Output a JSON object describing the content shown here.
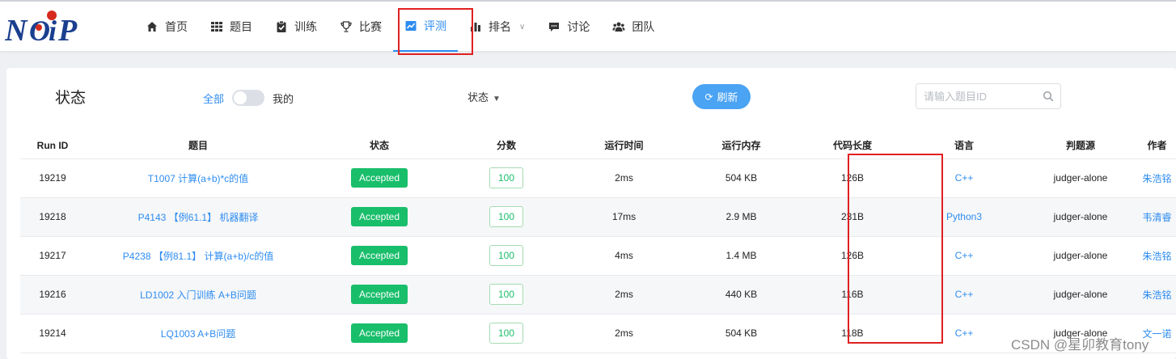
{
  "nav": {
    "items": [
      {
        "label": "首页",
        "icon": "home-icon"
      },
      {
        "label": "题目",
        "icon": "grid-icon"
      },
      {
        "label": "训练",
        "icon": "clipboard-check-icon"
      },
      {
        "label": "比赛",
        "icon": "trophy-icon"
      },
      {
        "label": "评测",
        "icon": "chart-line-icon"
      },
      {
        "label": "排名",
        "icon": "bar-chart-icon"
      },
      {
        "label": "讨论",
        "icon": "comment-icon"
      },
      {
        "label": "团队",
        "icon": "users-icon"
      }
    ],
    "active": "评测"
  },
  "card": {
    "title": "状态",
    "scope_all": "全部",
    "scope_mine": "我的",
    "status_filter": "状态",
    "refresh_label": "刷新",
    "search_placeholder": "请输入题目ID"
  },
  "table": {
    "headers": [
      "Run ID",
      "题目",
      "状态",
      "分数",
      "运行时间",
      "运行内存",
      "代码长度",
      "语言",
      "判题源",
      "作者"
    ],
    "rows": [
      {
        "run_id": "19219",
        "problem": "T1007 计算(a+b)*c的值",
        "status": "Accepted",
        "score": "100",
        "time": "2ms",
        "memory": "504 KB",
        "length": "126B",
        "language": "C++",
        "judger": "judger-alone",
        "author": "朱浩铭"
      },
      {
        "run_id": "19218",
        "problem": "P4143 【例61.1】 机器翻译",
        "status": "Accepted",
        "score": "100",
        "time": "17ms",
        "memory": "2.9 MB",
        "length": "231B",
        "language": "Python3",
        "judger": "judger-alone",
        "author": "韦清睿"
      },
      {
        "run_id": "19217",
        "problem": "P4238 【例81.1】 计算(a+b)/c的值",
        "status": "Accepted",
        "score": "100",
        "time": "4ms",
        "memory": "1.4 MB",
        "length": "126B",
        "language": "C++",
        "judger": "judger-alone",
        "author": "朱浩铭"
      },
      {
        "run_id": "19216",
        "problem": "LD1002 入门训练 A+B问题",
        "status": "Accepted",
        "score": "100",
        "time": "2ms",
        "memory": "440 KB",
        "length": "116B",
        "language": "C++",
        "judger": "judger-alone",
        "author": "朱浩铭"
      },
      {
        "run_id": "19214",
        "problem": "LQ1003 A+B问题",
        "status": "Accepted",
        "score": "100",
        "time": "2ms",
        "memory": "504 KB",
        "length": "118B",
        "language": "C++",
        "judger": "judger-alone",
        "author": "文一诺"
      }
    ]
  },
  "watermark": "CSDN @星卯教育tony",
  "colors": {
    "accent": "#2d8cf0",
    "accepted": "#19be6b",
    "highlight": "#e02020"
  }
}
